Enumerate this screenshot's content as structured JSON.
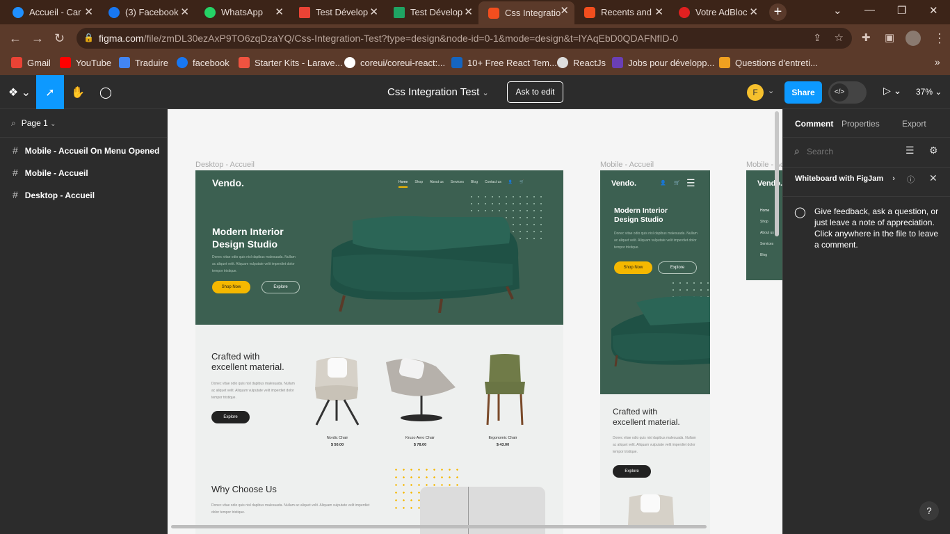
{
  "browser": {
    "tabs": [
      {
        "title": "Accueil - Car",
        "color": "#1f8fff"
      },
      {
        "title": "(3) Facebook",
        "color": "#1877f2"
      },
      {
        "title": "WhatsApp",
        "color": "#25d366"
      },
      {
        "title": "Test Dévelop",
        "color": "#ea4335"
      },
      {
        "title": "Test Dévelop",
        "color": "#1fa463"
      },
      {
        "title": "Css Integratio",
        "color": "#f24e1e"
      },
      {
        "title": "Recents and",
        "color": "#f24e1e"
      },
      {
        "title": "Votre AdBloc",
        "color": "#e02020"
      }
    ],
    "active_tab_index": 5,
    "url_host": "figma.com",
    "url_path": "/file/zmDL30ezAxP9TO6zqDzaYQ/Css-Integration-Test?type=design&node-id=0-1&mode=design&t=lYAqEbD0QDAFNfID-0",
    "bookmarks": [
      {
        "label": "Gmail",
        "color": "#ea4335"
      },
      {
        "label": "YouTube",
        "color": "#ff0000"
      },
      {
        "label": "Traduire",
        "color": "#4285f4"
      },
      {
        "label": "facebook",
        "color": "#1877f2"
      },
      {
        "label": "Starter Kits - Larave...",
        "color": "#f05340"
      },
      {
        "label": "coreui/coreui-react:...",
        "color": "#ffffff"
      },
      {
        "label": "10+ Free React Tem...",
        "color": "#1565c0"
      },
      {
        "label": "ReactJs",
        "color": "#dddddd"
      },
      {
        "label": "Jobs pour développ...",
        "color": "#6a3fb5"
      },
      {
        "label": "Questions d'entreti...",
        "color": "#f0a020"
      }
    ]
  },
  "figma": {
    "file_title": "Css Integration Test",
    "ask_to_edit": "Ask to edit",
    "avatar_letter": "F",
    "share_label": "Share",
    "zoom": "37%",
    "page_name": "Page 1",
    "layers": [
      "Mobile - Accueil On Menu Opened",
      "Mobile - Accueil",
      "Desktop - Accueil"
    ],
    "right_tabs": [
      "Comment",
      "Properties",
      "Export"
    ],
    "search_placeholder": "Search",
    "whiteboard_label": "Whiteboard with FigJam",
    "feedback_text": "Give feedback, ask a question, or just leave a note of appreciation. Click anywhere in the file to leave a comment.",
    "help_label": "?"
  },
  "design": {
    "frame_labels": [
      "Desktop - Accueil",
      "Mobile - Accueil",
      "Mobile - Accueil"
    ],
    "brand": "Vendo.",
    "nav": [
      "Home",
      "Shop",
      "About us",
      "Services",
      "Blog",
      "Contact us"
    ],
    "hero_title_1": "Modern Interior",
    "hero_title_2": "Design Studio",
    "hero_text": "Donec vitae odio quis nisl dapibus malesuada. Nullam ac aliquet velit. Aliquam vulputate velit imperdiet dolor tempor tristique.",
    "shop_now": "Shop Now",
    "explore": "Explore",
    "crafted_1": "Crafted with",
    "crafted_2": "excellent material.",
    "products": [
      {
        "name": "Nordic Chair",
        "price": "$ 50.00"
      },
      {
        "name": "Kruzo Aero Chair",
        "price": "$ 78.00"
      },
      {
        "name": "Ergonomic Chair",
        "price": "$ 43.00"
      }
    ],
    "why_title": "Why Choose Us",
    "why_text": "Donec vitae odio quis nisl dapibus malesuada. Nullam ac aliquet velit. Aliquam vulputate velit imperdiet dolor tempor tristique.",
    "accent": "#f5b800",
    "green": "#3c6051"
  }
}
